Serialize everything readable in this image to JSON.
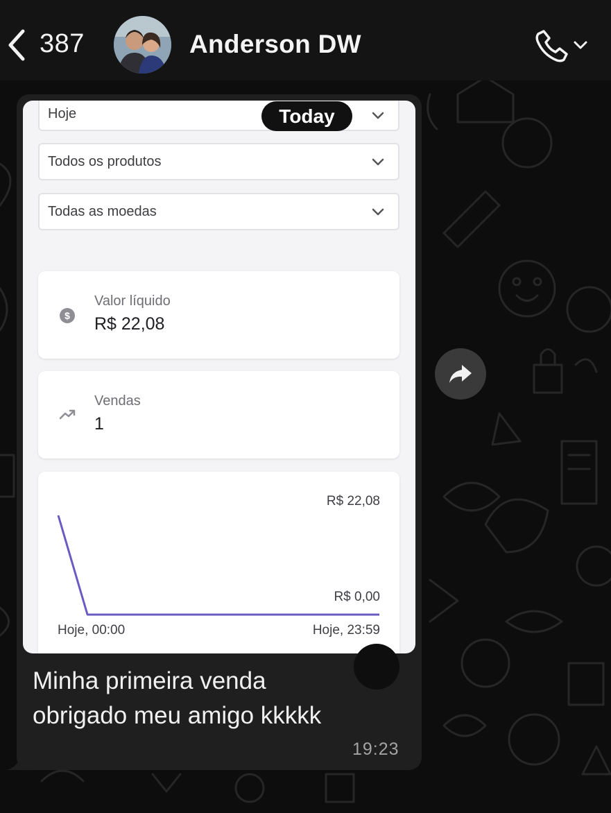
{
  "header": {
    "unread_count": "387",
    "contact_name": "Anderson DW",
    "back_icon": "chevron-left-icon",
    "call_icon": "phone-icon"
  },
  "message": {
    "screenshot": {
      "filters": [
        {
          "label": "Hoje"
        },
        {
          "label": "Todos os produtos"
        },
        {
          "label": "Todas as moedas"
        }
      ],
      "date_pill": "Today",
      "cards": [
        {
          "label": "Valor líquido",
          "value": "R$ 22,08",
          "icon": "dollar-coin-icon"
        },
        {
          "label": "Vendas",
          "value": "1",
          "icon": "trending-up-icon"
        }
      ]
    },
    "text_line1": "Minha primeira venda",
    "text_line2": "obrigado meu amigo kkkkk",
    "time": "19:23"
  },
  "chart_data": {
    "type": "line",
    "x": [
      "Hoje, 00:00",
      "Hoje, 23:59"
    ],
    "series": [
      {
        "values": [
          22.08,
          0,
          0,
          0,
          0,
          0,
          0,
          0,
          0,
          0,
          0,
          0
        ]
      }
    ],
    "y_labels": [
      "R$ 22,08",
      "R$ 0,00"
    ],
    "ylim": [
      0,
      22.08
    ],
    "line_color": "#6a5bc4",
    "grid": false
  },
  "colors": {
    "bubble": "#1f1f1f",
    "header": "#141414",
    "accent_line": "#6a5bc4"
  }
}
